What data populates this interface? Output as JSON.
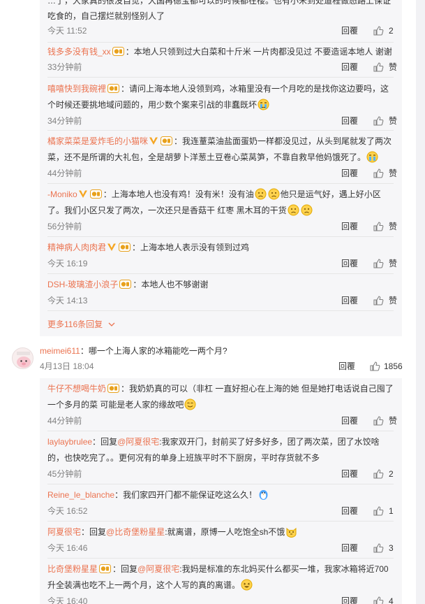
{
  "top_fragment": {
    "line1": "…了，大家真的很没自觉，大国再德宝都可以的时候都在楼。也有小米到处道程做态路上保证",
    "line2": "吃食的，自己摆烂就别怪别人了",
    "time": "今天 11:52",
    "reply_label": "回覆",
    "likes": "2"
  },
  "sub_comments": [
    {
      "user": "钱多多没有钱_xx",
      "text": "本地人只领到过大白菜和十斤米 一片肉都没见过 不要造谣本地人 谢谢",
      "time": "33分钟前",
      "reply_label": "回覆",
      "likes": "赞"
    },
    {
      "user": "嘻嘻快到我碗裡",
      "text1": "请问上海本地人没领到鸡，冰箱里没有一个月吃的是找你这边要吗，这",
      "text2": "个时候还要挑地域问题的，用少数个案来引战的非蠢既坏",
      "time": "34分钟前",
      "reply_label": "回覆",
      "likes": "赞"
    },
    {
      "user": "橘家菜菜是爱炸毛的小猫咪",
      "text1": "我连蕫菜油盐面蛋奶一样都没见过，从头到尾就发了两次",
      "text2": "菜，还不是所谓的大礼包，全是胡萝卜洋葱土豆卷心菜莴笋，不靠自救早他妈饿死了。",
      "time": "44分钟前",
      "reply_label": "回覆",
      "likes": "赞"
    },
    {
      "user": "-Moniko",
      "text1": "上海本地人也没有鸡！没有米！没有油",
      "text1b": "他只是运气好，遇上好小区",
      "text2": "了。我们小区只发了两次，一次还只是香菇干 红枣 黑木耳的干货",
      "time": "56分钟前",
      "reply_label": "回覆",
      "likes": "赞"
    },
    {
      "user": "精神病人肉肉君",
      "text": "上海本地人表示没有领到过鸡",
      "time": "今天 16:19",
      "reply_label": "回覆",
      "likes": "赞"
    },
    {
      "user": "DSH-玻璃渣小浪子",
      "text": "本地人也不够谢谢",
      "time": "今天 14:13",
      "reply_label": "回覆",
      "likes": "赞"
    }
  ],
  "more_replies": "更多116条回复",
  "main_comment": {
    "user": "meimei611",
    "text": "哪一个上海人家的冰箱能吃一两个月?",
    "time": "4月13日 18:04",
    "reply_label": "回覆",
    "likes": "1856"
  },
  "sub_comments2": [
    {
      "user": "牛仔不想喝牛奶",
      "text1": "我奶奶真的可以（非杠 一直好担心在上海的她 但是她打电话说自己囤了",
      "text2": "一个多月的菜 可能是老人家的缘故吧",
      "time": "44分钟前",
      "reply_label": "回覆",
      "likes": "赞"
    },
    {
      "user": "laylaybrulee",
      "prefix": "回复",
      "mention": "@阿夏很宅",
      "text1": ":我家双开门，封前买了好多好多，团了两次菜，团了水饺啥",
      "text2": "的，也快吃完了。。更何况有的单身上班族平时不下厨房，平时存货就不多",
      "time": "45分钟前",
      "reply_label": "回覆",
      "likes": "2"
    },
    {
      "user": "Reine_le_blanche",
      "text": "我们家四开门都不能保证吃这么久！",
      "time": "今天 16:52",
      "reply_label": "回覆",
      "likes": "1"
    },
    {
      "user": "阿夏很宅",
      "prefix": "回复",
      "mention": "@比奇堡粉星星",
      "text": ":就离谱，原博一人吃饱全sh不饿",
      "time": "今天 16:46",
      "reply_label": "回覆",
      "likes": "3"
    },
    {
      "user": "比奇堡粉星星",
      "prefix": "回复",
      "mention": "@阿夏很宅",
      "text1": ":我妈是标准的东北妈买什么都买一堆，我家冰箱将近700",
      "text2": "升全装满也吃不上一两个月，这个人写的真的离谱。",
      "time": "今天 16:40",
      "reply_label": "回覆",
      "likes": "4"
    }
  ],
  "colors": {
    "accent": "#eb7350",
    "badge": "#e8a11c",
    "vip": "#f5a623"
  }
}
